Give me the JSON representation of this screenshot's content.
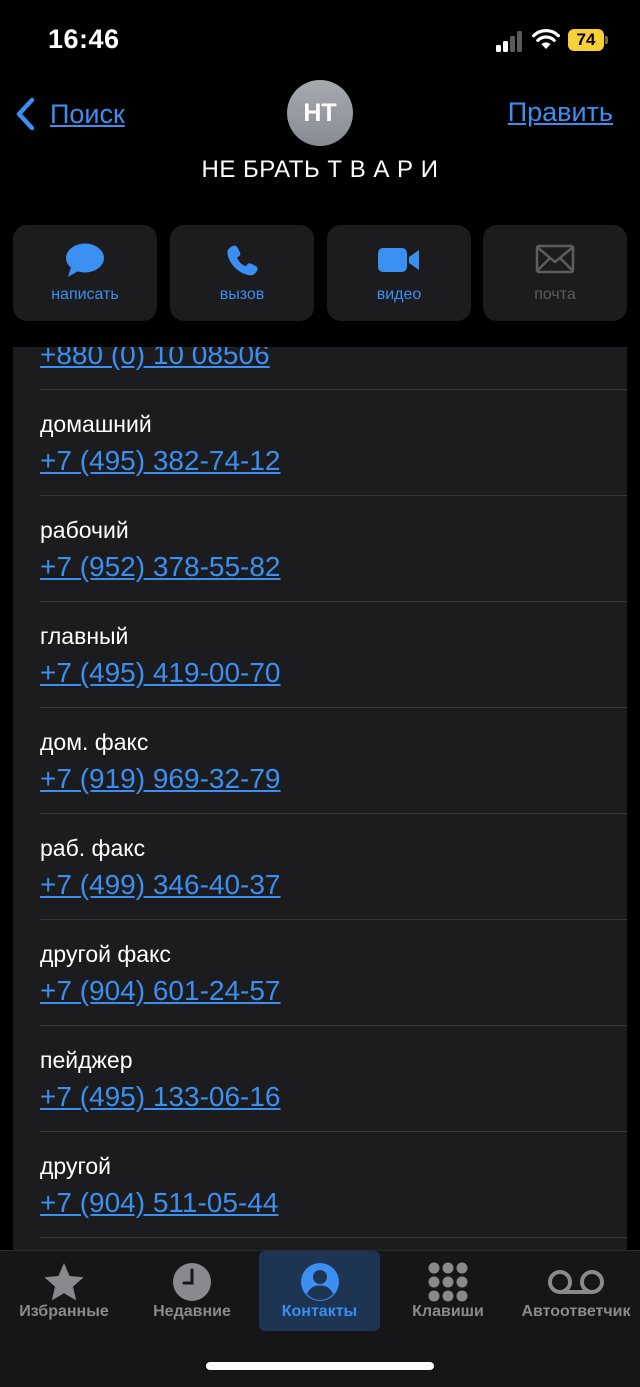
{
  "status_bar": {
    "time": "16:46",
    "battery": "74"
  },
  "nav": {
    "back_label": "Поиск",
    "edit_label": "Править"
  },
  "contact": {
    "initials": "НТ",
    "name": "НЕ БРАТЬ Т В А Р И"
  },
  "actions": [
    {
      "label": "написать",
      "icon": "message-icon"
    },
    {
      "label": "вызов",
      "icon": "phone-icon"
    },
    {
      "label": "видео",
      "icon": "video-icon"
    },
    {
      "label": "почта",
      "icon": "mail-icon"
    }
  ],
  "phones": [
    {
      "label": "",
      "number": "+880 (0) 10 08506"
    },
    {
      "label": "домашний",
      "number": "+7 (495) 382-74-12"
    },
    {
      "label": "рабочий",
      "number": "+7 (952) 378-55-82"
    },
    {
      "label": "главный",
      "number": "+7 (495) 419-00-70"
    },
    {
      "label": "дом. факс",
      "number": "+7 (919) 969-32-79"
    },
    {
      "label": "раб. факс",
      "number": "+7 (499) 346-40-37"
    },
    {
      "label": "другой факс",
      "number": "+7 (904) 601-24-57"
    },
    {
      "label": "пейджер",
      "number": "+7 (495) 133-06-16"
    },
    {
      "label": "другой",
      "number": "+7 (904) 511-05-44"
    }
  ],
  "tabs": [
    {
      "label": "Избранные",
      "icon": "star-icon"
    },
    {
      "label": "Недавние",
      "icon": "clock-icon"
    },
    {
      "label": "Контакты",
      "icon": "person-icon",
      "active": true
    },
    {
      "label": "Клавиши",
      "icon": "keypad-icon"
    },
    {
      "label": "Автоответчик",
      "icon": "voicemail-icon"
    }
  ],
  "colors": {
    "accent": "#3a8ff0",
    "background": "#000000",
    "card": "#1c1c1e",
    "battery": "#f7d038"
  }
}
